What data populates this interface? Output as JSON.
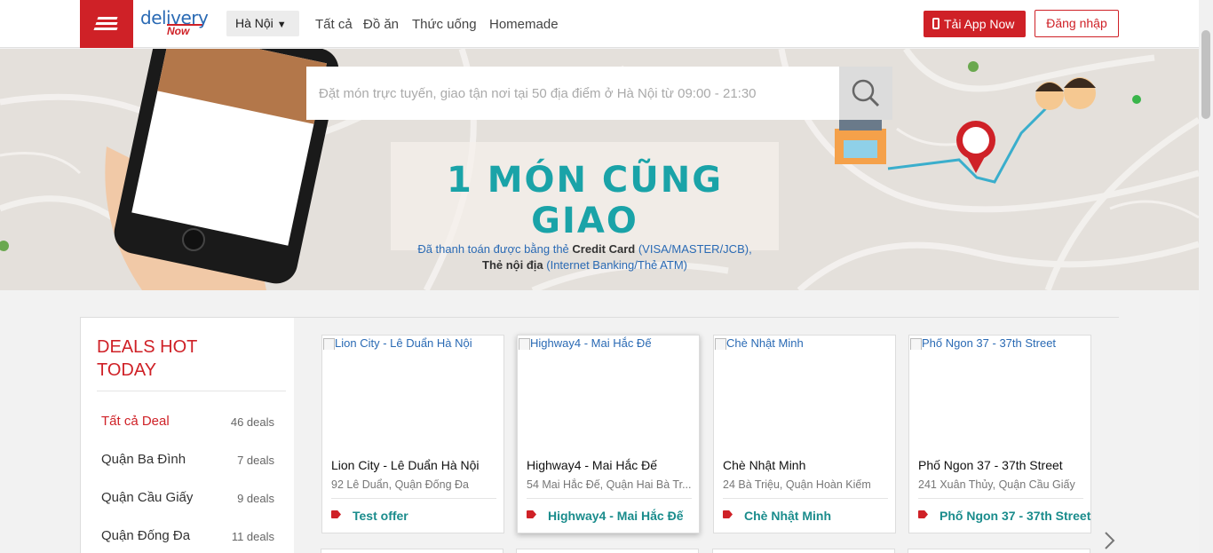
{
  "header": {
    "logo": {
      "line1": "delivery",
      "line2": "Now"
    },
    "city": "Hà Nội",
    "nav": [
      "Tất cả",
      "Đồ ăn",
      "Thức uống",
      "Homemade"
    ],
    "app_button": "Tải App Now",
    "login_button": "Đăng nhập"
  },
  "banner": {
    "search_placeholder": "Đặt món trực tuyến, giao tận nơi tại 50 địa điểm ở Hà Nội từ 09:00 - 21:30",
    "promo_title": "1 MÓN CŨNG GIAO",
    "promo_line1_a": "Đã thanh toán được bằng thẻ",
    "promo_line1_b": "Credit Card",
    "promo_line1_c": "(VISA/MASTER/JCB),",
    "promo_line2_a": "Thẻ nội địa",
    "promo_line2_b": "(Internet Banking/Thẻ ATM)"
  },
  "sidebar": {
    "title_line1": "DEALS HOT",
    "title_line2": "TODAY",
    "items": [
      {
        "label": "Tất cả Deal",
        "count": "46 deals"
      },
      {
        "label": "Quận Ba Đình",
        "count": "7 deals"
      },
      {
        "label": "Quận Cầu Giấy",
        "count": "9 deals"
      },
      {
        "label": "Quận Đống Đa",
        "count": "11 deals"
      }
    ]
  },
  "deals": [
    {
      "img_alt": "Lion City - Lê Duẩn Hà Nội",
      "name": "Lion City - Lê Duẩn Hà Nội",
      "address": "92 Lê Duẩn, Quận Đống Đa",
      "offer": "Test offer"
    },
    {
      "img_alt": "Highway4 - Mai Hắc Đế",
      "name": "Highway4 - Mai Hắc Đế",
      "address": "54 Mai Hắc Đế, Quận Hai Bà Tr...",
      "offer": "Highway4 - Mai Hắc Đế"
    },
    {
      "img_alt": "Chè Nhật Minh",
      "name": "Chè Nhật Minh",
      "address": "24 Bà Triệu, Quận Hoàn Kiếm",
      "offer": "Chè Nhật Minh"
    },
    {
      "img_alt": "Phố Ngon 37 - 37th Street",
      "name": "Phố Ngon 37 - 37th Street",
      "address": "241 Xuân Thủy, Quận Cầu Giấy",
      "offer": "Phố Ngon 37 - 37th Street"
    }
  ],
  "colors": {
    "brand_red": "#cf2127",
    "teal": "#1aa3a8",
    "link_blue": "#2a6ab4"
  }
}
